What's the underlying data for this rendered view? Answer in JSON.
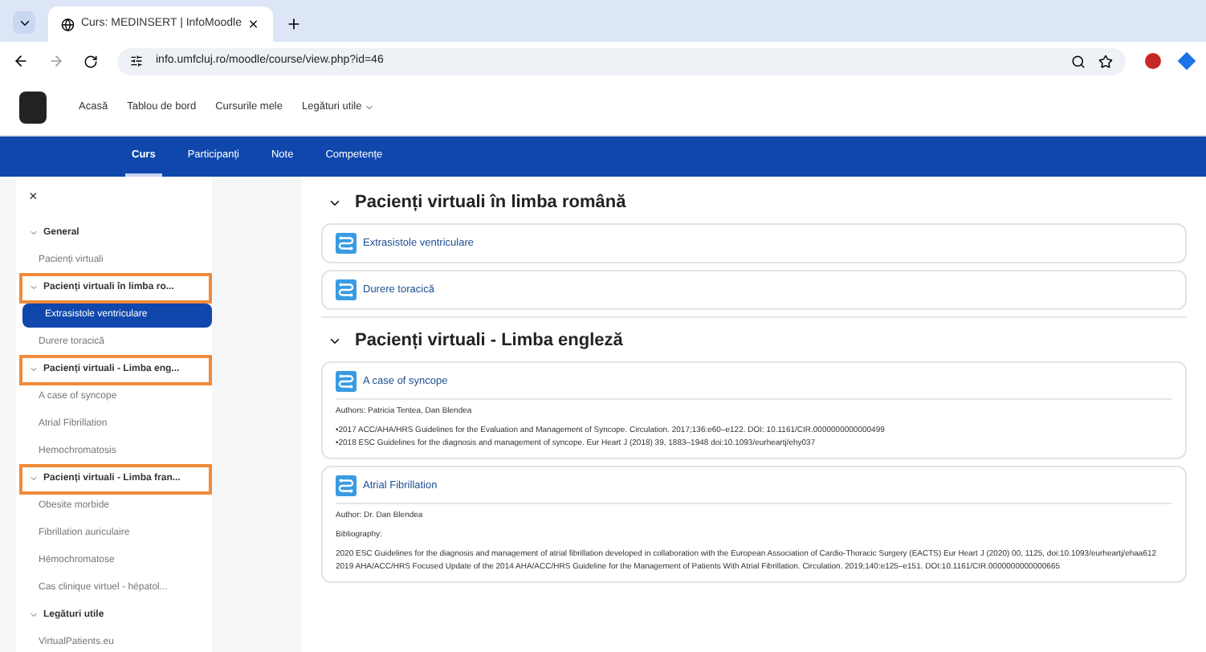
{
  "browser": {
    "tabs": [
      {
        "title": "Curs: MEDINSERT | InfoMoodle",
        "selected": true
      }
    ],
    "url": "info.umfcluj.ro/moodle/course/view.php?id=46"
  },
  "navbar": {
    "items": [
      {
        "label": "Acasă",
        "dropdown": false
      },
      {
        "label": "Tablou de bord",
        "dropdown": false
      },
      {
        "label": "Cursurile mele",
        "dropdown": false
      },
      {
        "label": "Legături utile",
        "dropdown": true
      }
    ]
  },
  "course_nav": [
    {
      "label": "Curs",
      "selected": true
    },
    {
      "label": "Participanți",
      "selected": false
    },
    {
      "label": "Note",
      "selected": false
    },
    {
      "label": "Competențe",
      "selected": false
    }
  ],
  "drawer": {
    "close": "×",
    "sections": [
      {
        "title": "General",
        "expanded": true,
        "highlighted": false,
        "children": [
          {
            "label": "Pacienți virtuali",
            "selected": false
          }
        ]
      },
      {
        "title": "Pacienți virtuali în limba ro...",
        "expanded": true,
        "highlighted": true,
        "children": [
          {
            "label": "Extrasistole ventriculare",
            "selected": true
          },
          {
            "label": "Durere toracică",
            "selected": false
          }
        ]
      },
      {
        "title": "Pacienți virtuali - Limba eng...",
        "expanded": true,
        "highlighted": true,
        "children": [
          {
            "label": "A case of syncope",
            "selected": false
          },
          {
            "label": "Atrial Fibrillation",
            "selected": false
          },
          {
            "label": "Hemochromatosis",
            "selected": false
          }
        ]
      },
      {
        "title": "Pacienți virtuali - Limba fran...",
        "expanded": true,
        "highlighted": true,
        "children": [
          {
            "label": "Obesite morbide",
            "selected": false
          },
          {
            "label": "Fibrillation auriculaire",
            "selected": false
          },
          {
            "label": "Hémochromatose",
            "selected": false
          },
          {
            "label": "Cas clinique virtuel - hépatol...",
            "selected": false
          }
        ]
      },
      {
        "title": "Legături utile",
        "expanded": true,
        "highlighted": false,
        "children": [
          {
            "label": "VirtualPatients.eu",
            "selected": false
          }
        ]
      }
    ]
  },
  "sections": [
    {
      "title": "Pacienți virtuali în limba română",
      "expanded": true,
      "activities": [
        {
          "name": "Extrasistole ventriculare",
          "kind": "lesson"
        },
        {
          "name": "Durere toracică",
          "kind": "lesson"
        }
      ]
    },
    {
      "title": "Pacienți virtuali - Limba engleză",
      "expanded": true,
      "activities": [
        {
          "name": "A case of syncope",
          "kind": "lesson",
          "details": [
            "Authors: Patricia Tentea, Dan Blendea",
            "•2017 ACC/AHA/HRS Guidelines for the Evaluation and Management of Syncope. Circulation. 2017;136:e60–e122. DOI: 10.1161/CIR.0000000000000499\n•2018 ESC Guidelines for the diagnosis and management of syncope. Eur Heart J (2018) 39, 1883–1948 doi:10.1093/eurheartj/ehy037"
          ]
        },
        {
          "name": "Atrial Fibrillation",
          "kind": "lesson",
          "details": [
            "Author: Dr. Dan Blendea",
            "Bibliography:",
            "2020 ESC Guidelines for the diagnosis and management of atrial fibrillation developed in collaboration with the European Association of Cardio-Thoracic Surgery (EACTS) Eur Heart J (2020) 00, 1125, doi:10.1093/eurheartj/ehaa612\n2019 AHA/ACC/HRS Focused Update of the 2014 AHA/ACC/HRS Guideline for the Management of Patients With Atrial Fibrillation. Circulation. 2019;140:e125–e151. DOI:10.1161/CIR.0000000000000665"
          ]
        }
      ]
    }
  ]
}
